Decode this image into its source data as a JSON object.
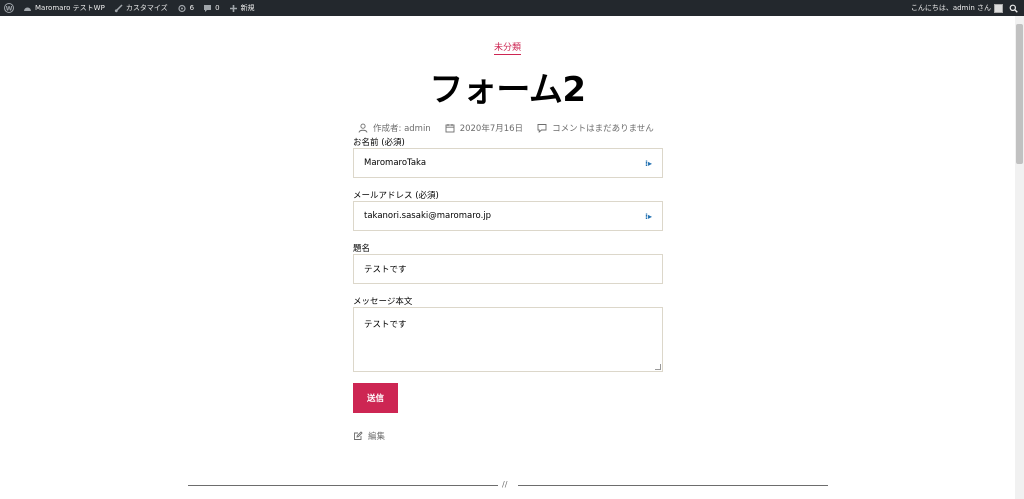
{
  "adminbar": {
    "site_name": "Maromaro テストWP",
    "customize": "カスタマイズ",
    "updates_count": "6",
    "comments_count": "0",
    "new_label": "新規",
    "greeting": "こんにちは、admin さん"
  },
  "post": {
    "category": "未分類",
    "title": "フォーム2",
    "author": "作成者: admin",
    "date": "2020年7月16日",
    "comments": "コメントはまだありません"
  },
  "form": {
    "name_label": "お名前 (必須)",
    "name_value": "MaromaroTaka",
    "email_label": "メールアドレス (必須)",
    "email_value": "takanori.sasaki@maromaro.jp",
    "subject_label": "題名",
    "subject_value": "テストです",
    "message_label": "メッセージ本文",
    "message_value": "テストです",
    "submit_label": "送信"
  },
  "footer": {
    "edit_label": "編集",
    "separator": "//"
  },
  "colors": {
    "accent": "#cd2653",
    "adminbar": "#23282d",
    "meta_text": "#6d6d6d"
  }
}
